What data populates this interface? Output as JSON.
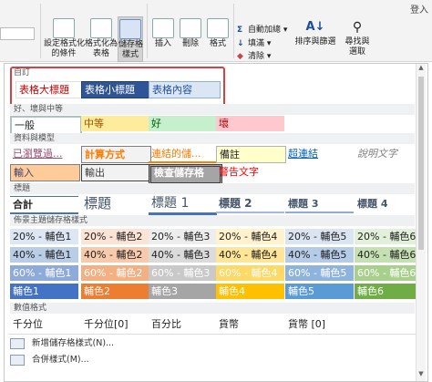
{
  "ribbon": {
    "login": "登入",
    "cond_format": "設定格式化\n的條件",
    "format_table": "格式化為\n表格",
    "cell_styles": "儲存格\n樣式",
    "insert": "插入",
    "delete": "刪除",
    "format": "格式",
    "autosum": "自動加總",
    "fill": "填滿",
    "clear": "清除",
    "sort_filter": "排序與篩選",
    "find_select": "尋找與\n選取"
  },
  "sections": {
    "custom": "自訂",
    "good_bad": "好、壞與中等",
    "data_model": "資料與模型",
    "titles": "標題",
    "themed": "佈景主題儲存格樣式",
    "number": "數值格式"
  },
  "custom_styles": [
    "表格大標題",
    "表格小標題",
    "表格內容"
  ],
  "good_bad": [
    "一般",
    "中等",
    "好",
    "壞"
  ],
  "data_model_row1": [
    "已瀏覽過...",
    "計算方式",
    "連結的儲...",
    "備註",
    "超連結",
    "說明文字"
  ],
  "data_model_row2": [
    "輸入",
    "輸出",
    "檢查儲存格",
    "警告文字"
  ],
  "titles": [
    "合計",
    "標題",
    "標題 1",
    "標題 2",
    "標題 3",
    "標題 4"
  ],
  "themed_rows": [
    [
      "20% - 輔色1",
      "20% - 輔色2",
      "20% - 輔色3",
      "20% - 輔色4",
      "20% - 輔色5",
      "20% - 輔色6"
    ],
    [
      "40% - 輔色1",
      "40% - 輔色2",
      "40% - 輔色3",
      "40% - 輔色4",
      "40% - 輔色5",
      "40% - 輔色6"
    ],
    [
      "60% - 輔色1",
      "60% - 輔色2",
      "60% - 輔色3",
      "60% - 輔色4",
      "60% - 輔色5",
      "60% - 輔色6"
    ],
    [
      "輔色1",
      "輔色2",
      "輔色3",
      "輔色4",
      "輔色5",
      "輔色6"
    ]
  ],
  "number_formats": [
    "千分位",
    "千分位[0]",
    "百分比",
    "貨幣",
    "貨幣 [0]"
  ],
  "menu": {
    "new_style": "新增儲存格樣式(N)...",
    "merge_styles": "合併樣式(M)..."
  },
  "colors": {
    "accent_red": "#d64040",
    "theme20": [
      "#dde7f3",
      "#fbe4d5",
      "#ededed",
      "#fff2cc",
      "#dbe5f1",
      "#e2efd9"
    ],
    "theme40": [
      "#b9cde6",
      "#f7caac",
      "#dbdbdb",
      "#ffe598",
      "#b6cbe7",
      "#c5e0b3"
    ],
    "theme60": [
      "#8eaadb",
      "#f4b083",
      "#c9c9c9",
      "#ffd966",
      "#8eb3dd",
      "#a8d08d"
    ],
    "theme100": [
      "#4472c4",
      "#ed7d31",
      "#a5a5a5",
      "#ffc000",
      "#5b9bd5",
      "#70ad47"
    ]
  }
}
